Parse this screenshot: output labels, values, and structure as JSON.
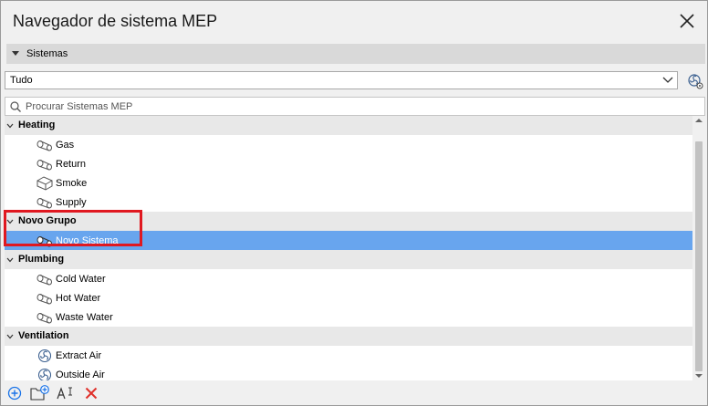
{
  "window": {
    "title": "Navegador de sistema MEP"
  },
  "section": {
    "label": "Sistemas"
  },
  "filter": {
    "selected": "Tudo"
  },
  "search": {
    "placeholder": "Procurar Sistemas MEP"
  },
  "tree": {
    "groups": [
      {
        "label": "Heating",
        "items": [
          {
            "label": "Gas",
            "icon": "pipe-icon"
          },
          {
            "label": "Return",
            "icon": "pipe-icon"
          },
          {
            "label": "Smoke",
            "icon": "duct-icon"
          },
          {
            "label": "Supply",
            "icon": "pipe-icon"
          }
        ]
      },
      {
        "label": "Novo Grupo",
        "items": [
          {
            "label": "Novo Sistema",
            "icon": "pipe-icon",
            "selected": true
          }
        ]
      },
      {
        "label": "Plumbing",
        "items": [
          {
            "label": "Cold Water",
            "icon": "pipe-icon"
          },
          {
            "label": "Hot Water",
            "icon": "pipe-icon"
          },
          {
            "label": "Waste Water",
            "icon": "pipe-icon"
          }
        ]
      },
      {
        "label": "Ventilation",
        "items": [
          {
            "label": "Extract Air",
            "icon": "fan-icon"
          },
          {
            "label": "Outside Air",
            "icon": "fan-icon"
          }
        ]
      }
    ]
  },
  "colors": {
    "selection": "#68a5ee",
    "highlight_border": "#e01820",
    "group_bg": "#e8e8e8",
    "accent_blue": "#1a73e8",
    "delete_red": "#e0302a"
  },
  "toolbar": {
    "icons": [
      "add-system-icon",
      "add-group-icon",
      "rename-icon",
      "delete-icon"
    ]
  }
}
